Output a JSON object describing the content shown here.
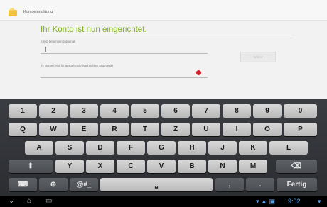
{
  "app": {
    "title": "Kontoeinrichtung",
    "heading": "Ihr Konto ist nun eingerichtet.",
    "field1_label": "Konto benennen (optional)",
    "field2_label": "Ihr Name (wird für ausgehende Nachrichten angezeigt)",
    "next_label": "Weiter"
  },
  "keyboard": {
    "row_numbers": [
      "1",
      "2",
      "3",
      "4",
      "5",
      "6",
      "7",
      "8",
      "9",
      "0"
    ],
    "row_q": [
      "Q",
      "W",
      "E",
      "R",
      "T",
      "Z",
      "U",
      "I",
      "O",
      "P"
    ],
    "row_a": [
      "A",
      "S",
      "D",
      "F",
      "G",
      "H",
      "J",
      "K",
      "L"
    ],
    "row_y": [
      "Y",
      "X",
      "C",
      "V",
      "B",
      "N",
      "M"
    ],
    "sym_label": "@#_",
    "comma_label": ",",
    "period_label": ".",
    "done_label": "Fertig",
    "backspace_label": "⌫",
    "shift_label": "⬆",
    "globe_label": "⊕",
    "keyboard_icon_label": "⌨",
    "space_label": "⎵"
  },
  "statusbar": {
    "time": "9:02"
  }
}
